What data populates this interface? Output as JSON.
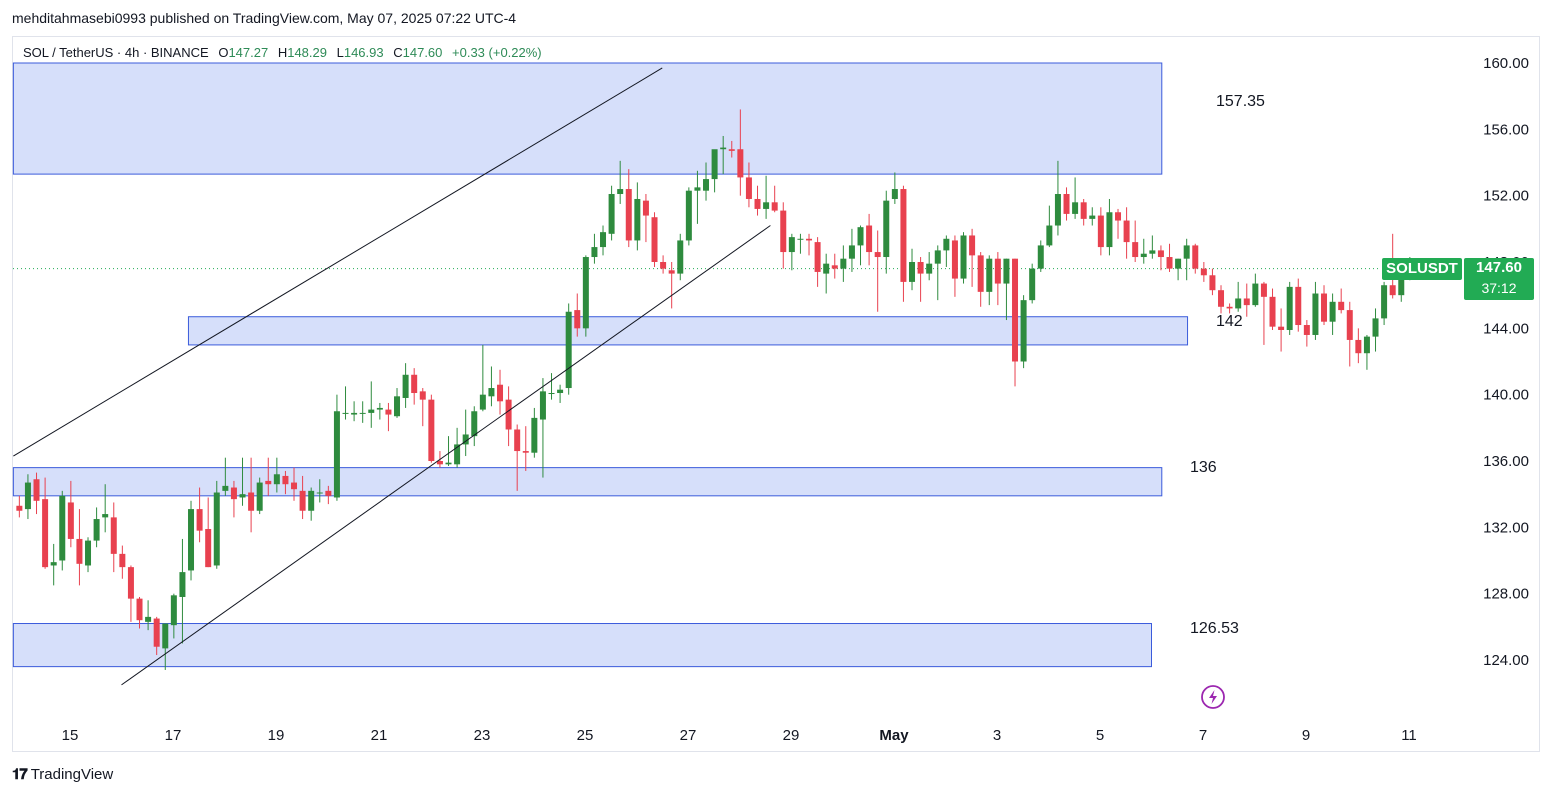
{
  "header": {
    "credit": "mehditahmasebi0993 published on TradingView.com, May 07, 2025 07:22 UTC-4"
  },
  "legend": {
    "symbol": "SOL / TetherUS · 4h · BINANCE",
    "o_label": "O",
    "o": "147.27",
    "h_label": "H",
    "h": "148.29",
    "l_label": "L",
    "l": "146.93",
    "c_label": "C",
    "c": "147.60",
    "change": "+0.33 (+0.22%)"
  },
  "price_tag": {
    "symbol": "SOLUSDT",
    "price": "147.60",
    "countdown": "37:12"
  },
  "zone_labels": {
    "z1": "157.35",
    "z2": "142",
    "z3": "136",
    "z4": "126.53"
  },
  "footer": {
    "brand": "TradingView"
  },
  "colors": {
    "up": "#2e8b3e",
    "down": "#e8414f",
    "zone_fill": "#d4ddfa",
    "zone_stroke": "#3b5bdb",
    "price_tag": "#22ab54"
  },
  "chart_data": {
    "type": "candlestick",
    "timeframe": "4h",
    "y_axis": {
      "ticks": [
        160,
        156,
        152,
        148,
        144,
        140,
        136,
        132,
        128,
        124
      ],
      "labels": [
        "160.00",
        "156.00",
        "152.00",
        "148.00",
        "144.00",
        "140.00",
        "136.00",
        "132.00",
        "128.00",
        "124.00"
      ],
      "range": [
        121.5,
        162.5
      ]
    },
    "x_axis": {
      "labels": [
        "15",
        "17",
        "19",
        "21",
        "23",
        "25",
        "27",
        "29",
        "May",
        "3",
        "5",
        "7",
        "9",
        "11"
      ],
      "label_day_index": [
        0,
        2,
        4,
        6,
        8,
        10,
        12,
        14,
        16,
        18,
        20,
        22,
        24,
        26
      ]
    },
    "start_day_index": -1.1,
    "candles_per_day": 6,
    "last_price": 147.6,
    "zones": [
      {
        "from_day": -1.1,
        "to_day": 21.2,
        "low": 153.3,
        "high": 160.0,
        "label": "157.35"
      },
      {
        "from_day": 2.3,
        "to_day": 21.7,
        "low": 143.0,
        "high": 144.7,
        "label": "142"
      },
      {
        "from_day": -1.1,
        "to_day": 21.2,
        "low": 133.9,
        "high": 135.6,
        "label": "136"
      },
      {
        "from_day": -1.1,
        "to_day": 21.0,
        "low": 123.6,
        "high": 126.2,
        "label": "126.53"
      }
    ],
    "trendlines": [
      {
        "from": [
          -1.1,
          136.3
        ],
        "to": [
          11.5,
          159.7
        ]
      },
      {
        "from": [
          1.0,
          122.5
        ],
        "to": [
          13.6,
          150.2
        ]
      }
    ],
    "candles": [
      [
        133.3,
        133.9,
        132.6,
        133.0
      ],
      [
        133.1,
        135.2,
        132.5,
        134.7
      ],
      [
        134.9,
        135.3,
        132.8,
        133.6
      ],
      [
        133.7,
        135.0,
        129.5,
        129.6
      ],
      [
        129.7,
        131.0,
        128.5,
        129.9
      ],
      [
        130.0,
        134.2,
        129.4,
        133.9
      ],
      [
        133.5,
        134.8,
        130.8,
        131.3
      ],
      [
        131.3,
        133.1,
        128.5,
        129.8
      ],
      [
        129.7,
        131.4,
        129.3,
        131.2
      ],
      [
        131.2,
        133.2,
        130.8,
        132.5
      ],
      [
        132.6,
        134.6,
        131.7,
        132.8
      ],
      [
        132.6,
        133.5,
        129.3,
        130.4
      ],
      [
        130.4,
        130.9,
        128.9,
        129.6
      ],
      [
        129.6,
        129.7,
        126.3,
        127.7
      ],
      [
        127.7,
        127.8,
        125.9,
        126.4
      ],
      [
        126.3,
        127.6,
        125.8,
        126.6
      ],
      [
        126.5,
        126.6,
        124.3,
        124.8
      ],
      [
        124.7,
        126.2,
        123.4,
        126.2
      ],
      [
        126.1,
        128.0,
        125.3,
        127.9
      ],
      [
        127.8,
        131.3,
        125.0,
        129.3
      ],
      [
        129.4,
        133.6,
        128.8,
        133.1
      ],
      [
        133.1,
        134.4,
        131.1,
        131.8
      ],
      [
        131.9,
        133.8,
        129.6,
        129.6
      ],
      [
        129.7,
        134.8,
        129.5,
        134.1
      ],
      [
        134.2,
        136.2,
        133.9,
        134.5
      ],
      [
        134.4,
        134.8,
        132.6,
        133.7
      ],
      [
        133.8,
        136.2,
        133.3,
        134.0
      ],
      [
        134.1,
        136.2,
        131.7,
        133.0
      ],
      [
        133.0,
        135.0,
        132.8,
        134.7
      ],
      [
        134.8,
        136.2,
        133.9,
        134.6
      ],
      [
        134.6,
        136.2,
        134.1,
        135.2
      ],
      [
        135.1,
        135.4,
        134.0,
        134.6
      ],
      [
        134.7,
        135.6,
        133.6,
        134.3
      ],
      [
        134.2,
        135.1,
        132.5,
        133.0
      ],
      [
        133.0,
        134.4,
        132.4,
        134.2
      ],
      [
        134.1,
        134.9,
        133.5,
        134.1
      ],
      [
        134.2,
        134.5,
        133.4,
        133.9
      ],
      [
        133.8,
        140.0,
        133.6,
        139.0
      ],
      [
        138.9,
        140.5,
        138.5,
        138.9
      ],
      [
        138.8,
        139.6,
        138.4,
        138.9
      ],
      [
        138.9,
        139.6,
        138.3,
        138.9
      ],
      [
        138.9,
        140.8,
        138.0,
        139.1
      ],
      [
        139.1,
        139.5,
        138.5,
        139.2
      ],
      [
        139.1,
        139.5,
        137.8,
        138.8
      ],
      [
        138.7,
        140.4,
        138.6,
        139.9
      ],
      [
        139.8,
        141.9,
        139.2,
        141.2
      ],
      [
        141.2,
        141.6,
        139.4,
        140.1
      ],
      [
        140.2,
        140.4,
        138.1,
        139.7
      ],
      [
        139.7,
        140.0,
        135.9,
        136.0
      ],
      [
        136.0,
        136.6,
        135.6,
        135.8
      ],
      [
        135.8,
        137.5,
        135.7,
        135.9
      ],
      [
        135.8,
        138.0,
        135.6,
        137.0
      ],
      [
        137.0,
        139.1,
        136.3,
        137.6
      ],
      [
        137.5,
        139.3,
        136.9,
        139.0
      ],
      [
        139.1,
        143.0,
        139.0,
        140.0
      ],
      [
        139.9,
        141.7,
        139.3,
        140.4
      ],
      [
        140.6,
        141.5,
        138.8,
        139.6
      ],
      [
        139.7,
        140.5,
        136.9,
        137.9
      ],
      [
        137.9,
        138.2,
        134.2,
        136.6
      ],
      [
        136.6,
        138.1,
        135.4,
        136.5
      ],
      [
        136.5,
        139.2,
        136.2,
        138.6
      ],
      [
        138.5,
        141.0,
        135.0,
        140.2
      ],
      [
        140.1,
        141.3,
        139.7,
        140.1
      ],
      [
        140.1,
        140.6,
        139.5,
        140.3
      ],
      [
        140.4,
        145.5,
        140.0,
        145.0
      ],
      [
        145.1,
        146.1,
        143.5,
        144.0
      ],
      [
        144.0,
        148.4,
        143.5,
        148.3
      ],
      [
        148.3,
        149.7,
        147.9,
        148.9
      ],
      [
        148.9,
        150.2,
        148.4,
        149.8
      ],
      [
        149.7,
        152.6,
        149.3,
        152.1
      ],
      [
        152.1,
        154.1,
        151.5,
        152.4
      ],
      [
        152.4,
        153.6,
        148.9,
        149.3
      ],
      [
        149.3,
        152.8,
        148.7,
        151.8
      ],
      [
        151.7,
        152.1,
        149.2,
        150.8
      ],
      [
        150.7,
        151.0,
        147.7,
        148.0
      ],
      [
        148.0,
        148.4,
        147.3,
        147.6
      ],
      [
        147.5,
        148.0,
        145.2,
        147.3
      ],
      [
        147.3,
        149.7,
        146.9,
        149.3
      ],
      [
        149.3,
        152.5,
        149.0,
        152.3
      ],
      [
        152.3,
        153.5,
        150.3,
        152.5
      ],
      [
        152.3,
        154.0,
        151.7,
        153.0
      ],
      [
        153.0,
        154.0,
        152.2,
        154.8
      ],
      [
        154.8,
        155.6,
        153.3,
        154.9
      ],
      [
        154.8,
        155.3,
        154.3,
        154.7
      ],
      [
        154.8,
        157.2,
        152.0,
        153.1
      ],
      [
        153.1,
        154.0,
        151.3,
        151.8
      ],
      [
        151.8,
        152.6,
        150.8,
        151.2
      ],
      [
        151.2,
        153.2,
        150.6,
        151.6
      ],
      [
        151.6,
        152.6,
        151.0,
        151.1
      ],
      [
        151.1,
        151.6,
        147.6,
        148.6
      ],
      [
        148.6,
        149.7,
        147.5,
        149.5
      ],
      [
        149.4,
        149.7,
        148.5,
        149.4
      ],
      [
        149.4,
        149.7,
        148.4,
        149.3
      ],
      [
        149.2,
        149.5,
        146.5,
        147.4
      ],
      [
        147.3,
        148.5,
        146.1,
        147.9
      ],
      [
        147.8,
        148.5,
        147.0,
        147.6
      ],
      [
        147.6,
        149.0,
        146.8,
        148.2
      ],
      [
        148.2,
        150.0,
        147.4,
        149.0
      ],
      [
        149.0,
        150.2,
        147.8,
        150.1
      ],
      [
        150.2,
        150.9,
        147.8,
        148.6
      ],
      [
        148.6,
        149.9,
        145.0,
        148.3
      ],
      [
        148.3,
        152.3,
        147.3,
        151.7
      ],
      [
        151.8,
        153.4,
        151.5,
        152.4
      ],
      [
        152.4,
        152.6,
        145.6,
        146.8
      ],
      [
        146.8,
        148.8,
        146.3,
        148.0
      ],
      [
        148.0,
        148.3,
        145.6,
        147.3
      ],
      [
        147.3,
        148.6,
        146.9,
        147.9
      ],
      [
        147.9,
        149.0,
        145.7,
        148.7
      ],
      [
        148.7,
        149.6,
        147.7,
        149.4
      ],
      [
        149.3,
        149.6,
        145.9,
        147.0
      ],
      [
        147.0,
        149.8,
        146.7,
        149.6
      ],
      [
        149.6,
        150.0,
        146.5,
        148.4
      ],
      [
        148.4,
        148.6,
        145.3,
        146.2
      ],
      [
        146.2,
        148.4,
        145.4,
        148.2
      ],
      [
        148.2,
        148.6,
        145.4,
        146.7
      ],
      [
        146.7,
        148.2,
        144.5,
        148.2
      ],
      [
        148.2,
        148.2,
        140.5,
        142.0
      ],
      [
        142.0,
        146.0,
        141.6,
        145.7
      ],
      [
        145.7,
        147.9,
        145.5,
        147.6
      ],
      [
        147.6,
        149.3,
        147.4,
        149.0
      ],
      [
        149.0,
        151.4,
        148.9,
        150.2
      ],
      [
        150.2,
        154.1,
        149.6,
        152.1
      ],
      [
        152.1,
        152.5,
        150.5,
        150.9
      ],
      [
        150.9,
        153.1,
        150.6,
        151.6
      ],
      [
        151.6,
        151.8,
        150.2,
        150.6
      ],
      [
        150.6,
        151.3,
        150.2,
        150.8
      ],
      [
        150.8,
        151.3,
        148.4,
        148.9
      ],
      [
        148.9,
        151.8,
        148.4,
        151.0
      ],
      [
        151.0,
        151.2,
        149.4,
        150.5
      ],
      [
        150.5,
        151.3,
        148.2,
        149.2
      ],
      [
        149.2,
        150.5,
        148.0,
        148.3
      ],
      [
        148.3,
        149.4,
        147.9,
        148.5
      ],
      [
        148.5,
        149.6,
        148.2,
        148.7
      ],
      [
        148.7,
        149.0,
        147.5,
        148.3
      ],
      [
        148.3,
        149.1,
        147.4,
        147.6
      ],
      [
        147.6,
        148.2,
        146.9,
        148.2
      ],
      [
        148.2,
        149.4,
        146.9,
        149.0
      ],
      [
        149.0,
        149.1,
        147.3,
        147.6
      ],
      [
        147.6,
        148.0,
        146.8,
        147.2
      ],
      [
        147.2,
        147.6,
        146.0,
        146.3
      ],
      [
        146.3,
        146.6,
        144.9,
        145.3
      ],
      [
        145.3,
        145.5,
        144.9,
        145.2
      ],
      [
        145.2,
        146.8,
        145.0,
        145.8
      ],
      [
        145.8,
        146.7,
        144.7,
        145.4
      ],
      [
        145.4,
        147.3,
        145.3,
        146.7
      ],
      [
        146.7,
        146.8,
        143.0,
        145.9
      ],
      [
        145.9,
        146.4,
        143.9,
        144.1
      ],
      [
        144.1,
        145.2,
        142.6,
        143.9
      ],
      [
        143.9,
        146.8,
        143.6,
        146.5
      ],
      [
        146.5,
        147.0,
        143.8,
        144.2
      ],
      [
        144.2,
        144.5,
        142.9,
        143.6
      ],
      [
        143.6,
        146.8,
        143.3,
        146.1
      ],
      [
        146.1,
        146.6,
        144.2,
        144.4
      ],
      [
        144.4,
        146.1,
        143.6,
        145.6
      ],
      [
        145.6,
        146.4,
        144.9,
        145.1
      ],
      [
        145.1,
        145.6,
        141.7,
        143.3
      ],
      [
        143.3,
        144.0,
        141.9,
        142.5
      ],
      [
        142.5,
        143.6,
        141.5,
        143.5
      ],
      [
        143.5,
        145.2,
        142.6,
        144.6
      ],
      [
        144.6,
        146.8,
        144.2,
        146.6
      ],
      [
        146.6,
        149.7,
        145.8,
        146.0
      ],
      [
        146.0,
        147.6,
        145.6,
        147.2
      ],
      [
        147.2,
        148.3,
        146.9,
        147.6
      ]
    ]
  }
}
